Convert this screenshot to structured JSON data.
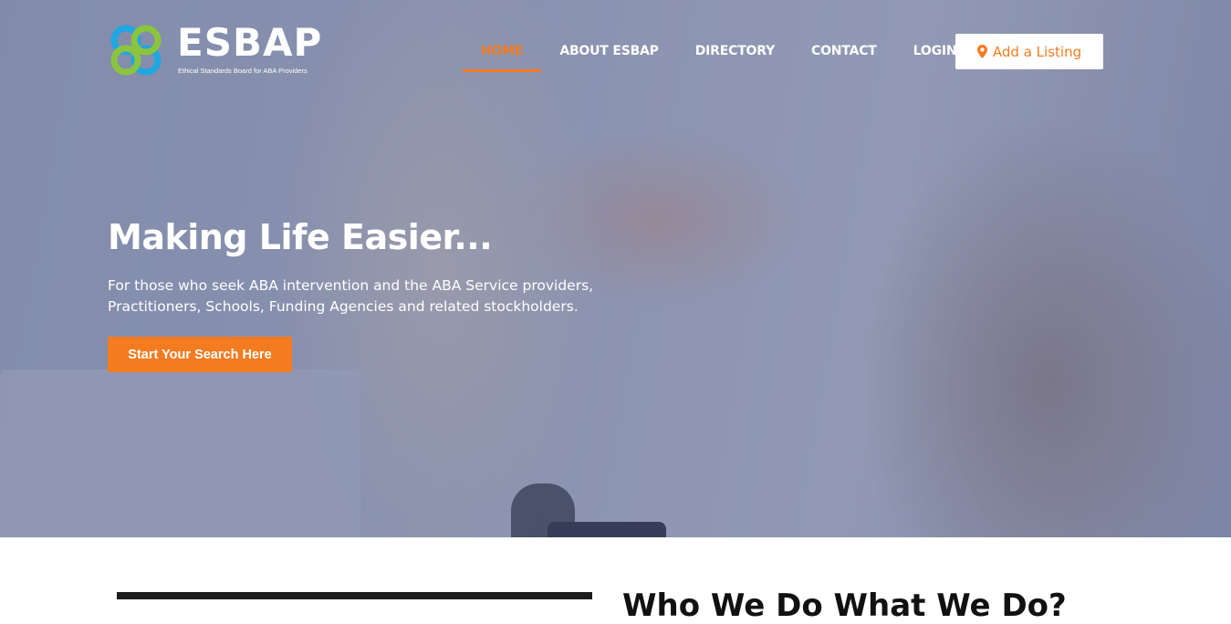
{
  "brand": {
    "name": "ESBAP",
    "tagline": "Ethical Standards Board for ABA Providers",
    "colors": {
      "accent": "#f47b20",
      "logo_green": "#8bc53f",
      "logo_blue": "#1ea7e1"
    }
  },
  "nav": {
    "items": [
      {
        "label": "HOME",
        "active": true
      },
      {
        "label": "ABOUT ESBAP",
        "active": false
      },
      {
        "label": "DIRECTORY",
        "active": false
      },
      {
        "label": "CONTACT",
        "active": false
      },
      {
        "label": "LOGIN",
        "active": false
      }
    ],
    "add_listing": {
      "label": "Add a Listing",
      "icon": "map-pin-icon"
    }
  },
  "hero": {
    "headline": "Making Life Easier...",
    "subtext_line1": "For those who seek ABA intervention and the ABA Service providers,",
    "subtext_line2": "Practitioners, Schools, Funding Agencies and related stockholders.",
    "cta_label": "Start Your Search Here"
  },
  "section": {
    "heading": "Who We Do What We Do?"
  }
}
